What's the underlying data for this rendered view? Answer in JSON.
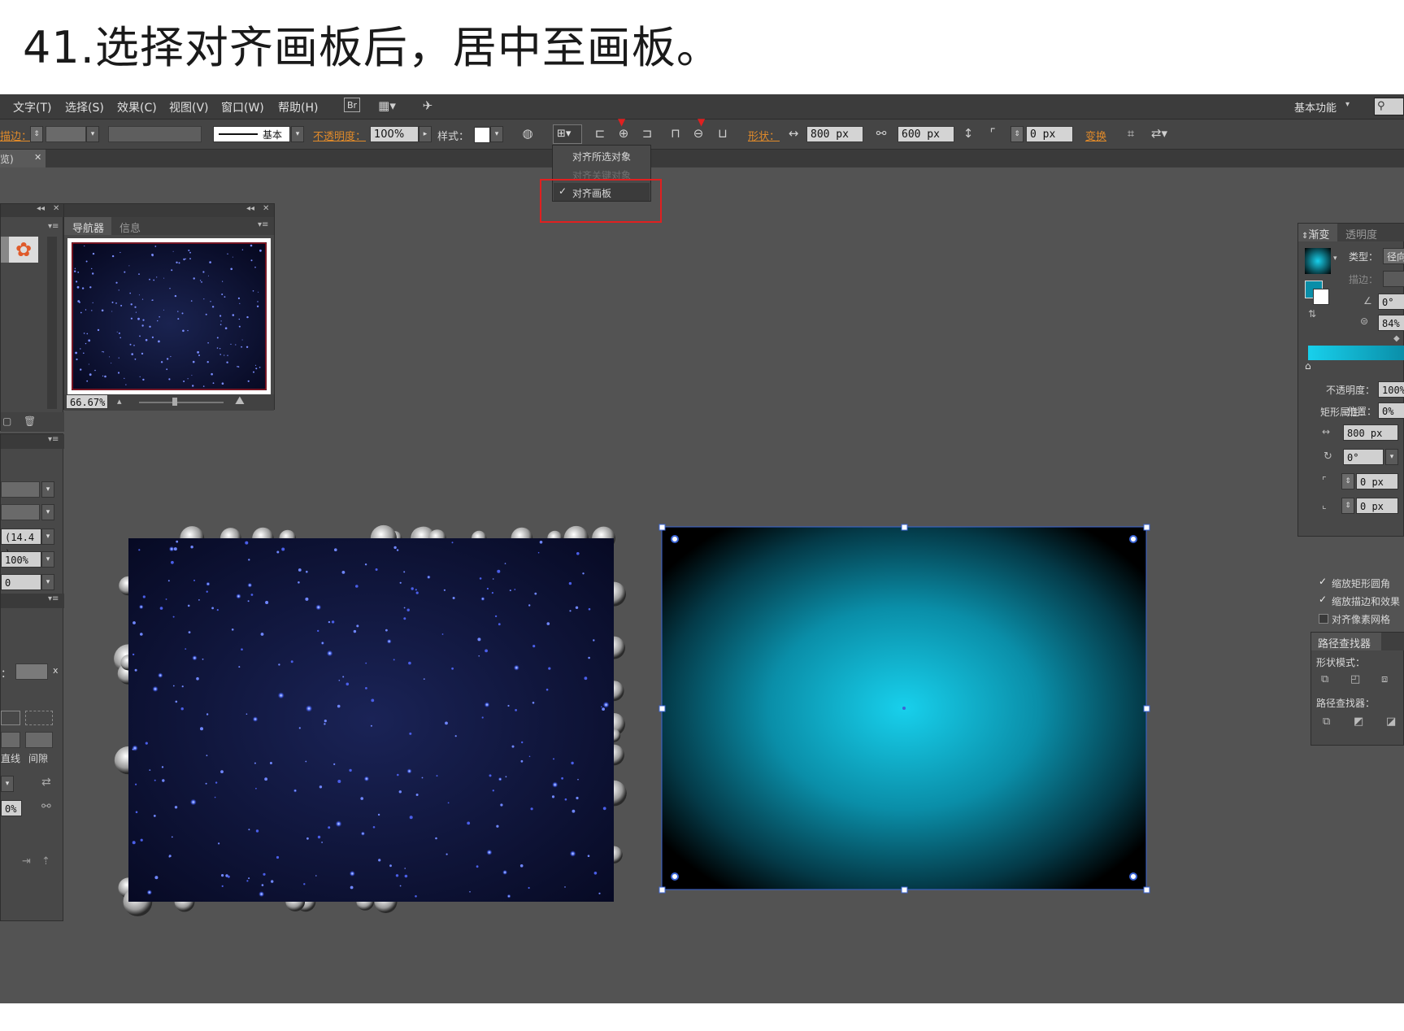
{
  "caption": "41.选择对齐画板后，居中至画板。",
  "menubar": {
    "items": [
      "文字(T)",
      "选择(S)",
      "效果(C)",
      "视图(V)",
      "窗口(W)",
      "帮助(H)"
    ],
    "br_label": "Br",
    "workspace": "基本功能"
  },
  "controlbar": {
    "stroke_label": "描边：",
    "brush_label": "基本",
    "opacity_label": "不透明度：",
    "opacity_value": "100%",
    "style_label": "样式：",
    "shape_label": "形状：",
    "width_value": "800 px",
    "height_value": "600 px",
    "corner_value": "0 px",
    "transform_label": "变换"
  },
  "doc_tab": {
    "label": "览)"
  },
  "align_menu": {
    "items": [
      {
        "label": "对齐所选对象",
        "enabled": true,
        "checked": false
      },
      {
        "label": "对齐关键对象",
        "enabled": false,
        "checked": false
      },
      {
        "label": "对齐画板",
        "enabled": true,
        "checked": true
      }
    ]
  },
  "navigator": {
    "tabs": [
      "导航器",
      "信息"
    ],
    "zoom": "66.67%"
  },
  "left_panel": {
    "field_1": "(14.4 )",
    "field_2": "100%",
    "field_3": "0",
    "label_colon": "：",
    "unit": "x",
    "label_a": "直线",
    "label_b": "间隙",
    "pct": "0%"
  },
  "gradient_panel": {
    "tabs": [
      "渐变",
      "透明度"
    ],
    "type_label": "类型：",
    "type_value": "径向",
    "stroke_label": "描边：",
    "angle_value": "0°",
    "aspect_value": "84%",
    "opacity_label": "不透明度：",
    "opacity_value": "100%",
    "location_label": "位置：",
    "location_value": "0%"
  },
  "rect_props": {
    "title": "矩形属性：",
    "width_value": "800 px",
    "rotate_value": "0°",
    "corner1_value": "0 px",
    "corner2_value": "0 px",
    "options": [
      {
        "label": "缩放矩形圆角",
        "checked": true
      },
      {
        "label": "缩放描边和效果",
        "checked": true
      },
      {
        "label": "对齐像素网格",
        "checked": false
      }
    ]
  },
  "pathfinder": {
    "tab": "路径查找器",
    "shape_modes_label": "形状模式：",
    "pathfinders_label": "路径查找器："
  },
  "colors": {
    "app_bg": "#535353",
    "star_bg": "#0c0f2e",
    "gradient_center": "#18d0ec",
    "gradient_edge": "#000000",
    "selection": "#3a64d6",
    "highlight": "#e02020"
  }
}
